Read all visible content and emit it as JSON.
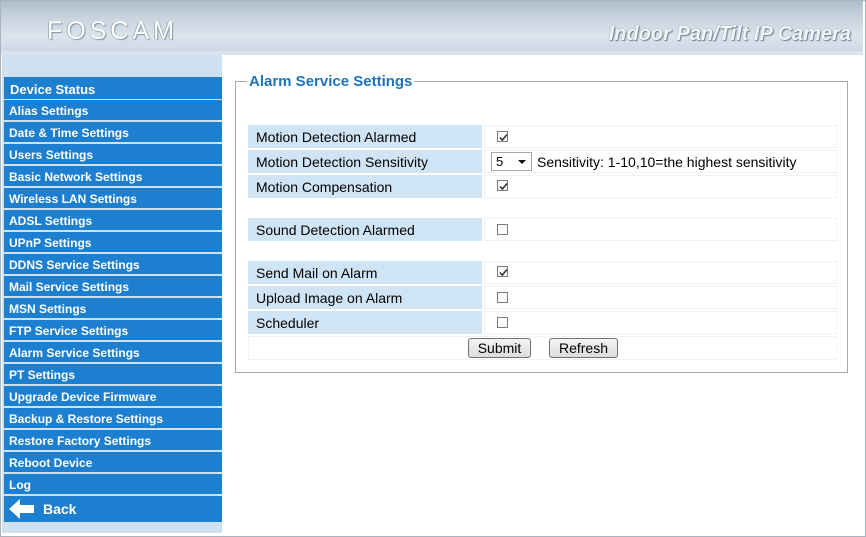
{
  "header": {
    "logo": "FOSCAM",
    "product": "Indoor Pan/Tilt IP Camera"
  },
  "sidebar": {
    "items": [
      {
        "label": "Device Status"
      },
      {
        "label": "Alias Settings"
      },
      {
        "label": "Date & Time Settings"
      },
      {
        "label": "Users Settings"
      },
      {
        "label": "Basic Network Settings"
      },
      {
        "label": "Wireless LAN Settings"
      },
      {
        "label": "ADSL Settings"
      },
      {
        "label": "UPnP Settings"
      },
      {
        "label": "DDNS Service Settings"
      },
      {
        "label": "Mail Service Settings"
      },
      {
        "label": "MSN Settings"
      },
      {
        "label": "FTP Service Settings"
      },
      {
        "label": "Alarm Service Settings"
      },
      {
        "label": "PT Settings"
      },
      {
        "label": "Upgrade Device Firmware"
      },
      {
        "label": "Backup & Restore Settings"
      },
      {
        "label": "Restore Factory Settings"
      },
      {
        "label": "Reboot Device"
      },
      {
        "label": "Log"
      }
    ],
    "back_label": "Back"
  },
  "main": {
    "legend": "Alarm Service Settings",
    "rows": {
      "motion_alarmed": {
        "label": "Motion Detection Alarmed",
        "checked": true
      },
      "motion_sensitivity": {
        "label": "Motion Detection Sensitivity",
        "value": "5",
        "hint": "Sensitivity: 1-10,10=the highest sensitivity"
      },
      "motion_compensation": {
        "label": "Motion Compensation",
        "checked": true
      },
      "sound_alarmed": {
        "label": "Sound Detection Alarmed",
        "checked": false
      },
      "send_mail": {
        "label": "Send Mail on Alarm",
        "checked": true
      },
      "upload_image": {
        "label": "Upload Image on Alarm",
        "checked": false
      },
      "scheduler": {
        "label": "Scheduler",
        "checked": false
      }
    },
    "submit_label": "Submit",
    "refresh_label": "Refresh"
  },
  "colors": {
    "nav_bg": "#1d7fd0",
    "label_bg": "#cfe5f6",
    "legend_text": "#1f73ba"
  },
  "icons": {
    "back": "back-arrow-icon",
    "check": "check-icon"
  }
}
